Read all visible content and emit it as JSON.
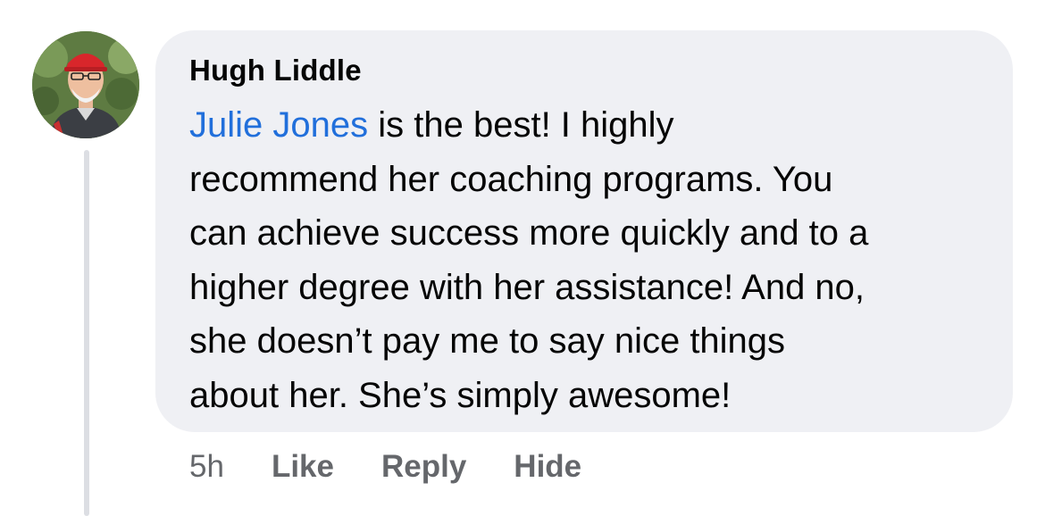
{
  "comment": {
    "author": "Hugh Liddle",
    "mention": "Julie Jones",
    "text": " is the best!  I highly\nrecommend her coaching programs.  You\ncan achieve success more quickly and to a\nhigher degree with her assistance!  And no,\nshe doesn’t pay me to say nice things\nabout her.  She’s simply awesome!",
    "timestamp": "5h",
    "actions": {
      "like": "Like",
      "reply": "Reply",
      "hide": "Hide"
    }
  },
  "colors": {
    "bubble": "#eff0f4",
    "mention": "#216fdb",
    "meta": "#65676b",
    "text": "#050505"
  },
  "icons": {
    "avatar": "user-avatar-photo"
  }
}
